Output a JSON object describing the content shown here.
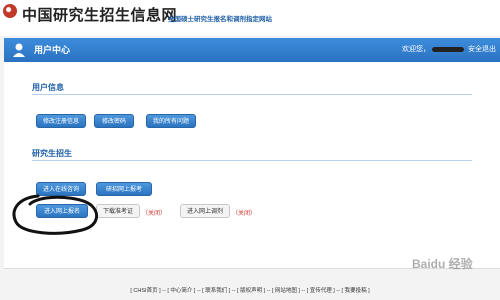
{
  "site": {
    "title": "中国研究生招生信息网",
    "subtitle": "全国硕士研究生报名和调剂指定网站"
  },
  "top_bar": {
    "title": "用户中心",
    "welcome": "欢迎您，",
    "logout": "安全退出"
  },
  "user_info": {
    "heading": "用户信息",
    "buttons": [
      "修改注册信息",
      "修改密码",
      "我的所有问题"
    ]
  },
  "grad_admission": {
    "heading": "研究生招生",
    "row1": [
      "进入在线咨询",
      "研招网上报考"
    ],
    "row2": {
      "apply": "进入网上报名",
      "print_ticket": "下载准考证",
      "print_ticket_status": "（关闭）",
      "adjustment": "进入网上调剂",
      "adjustment_status": "（关闭）"
    }
  },
  "footer": {
    "links": "[ CHSI首页 ] -- [ 中心简介 ] -- [ 联系我们 ] -- [ 版权声明 ] -- [ 网站地图 ] -- [ 宣传代理 ] -- [ 我要投稿 ]"
  },
  "watermark": {
    "text": "Baidu 经验"
  },
  "colors": {
    "brand_blue": "#2a72c1",
    "status_red": "#d0342c",
    "heading_blue": "#1f5fa6"
  }
}
